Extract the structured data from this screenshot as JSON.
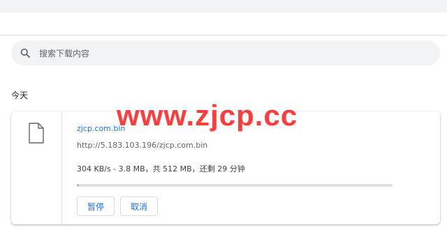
{
  "search": {
    "placeholder": "搜索下载内容",
    "icon": "search-icon"
  },
  "section": {
    "title": "今天"
  },
  "download": {
    "file_name": "zjcp.com.bin",
    "url": "http://5.183.103.196/zjcp.com.bin",
    "status": "304 KB/s - 3.8 MB，共 512 MB，还剩 29 分钟",
    "progress_fraction": 0.0074,
    "icon": "file-icon"
  },
  "buttons": {
    "pause": "暂停",
    "cancel": "取消"
  },
  "watermark": {
    "text": "www.zjcp.cc"
  },
  "colors": {
    "accent": "#1a73e8",
    "watermark": "#ff3b3b",
    "search_bg": "#f1f3f4"
  }
}
